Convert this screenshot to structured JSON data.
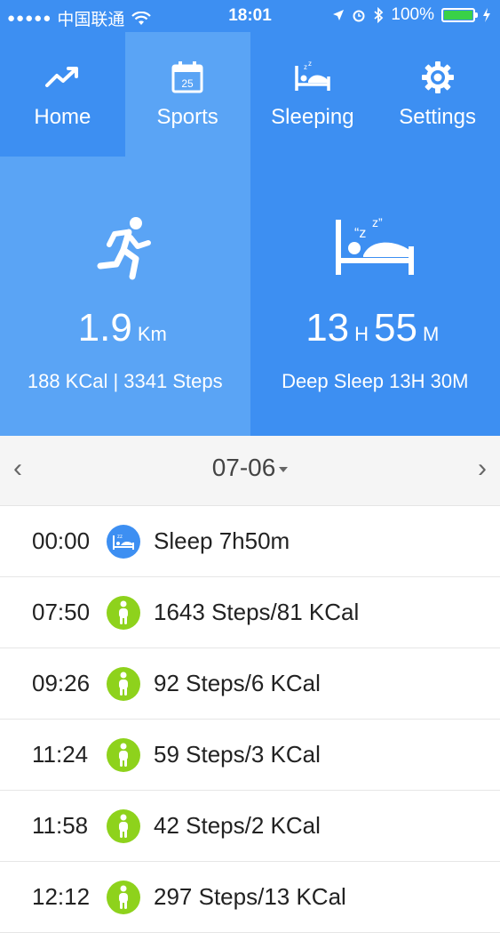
{
  "status_bar": {
    "signal": "●●●●●",
    "carrier": "中国联通",
    "time": "18:01",
    "battery": "100%",
    "battery_level": 100
  },
  "nav": {
    "tabs": [
      {
        "label": "Home",
        "icon": "trend-icon",
        "active": false
      },
      {
        "label": "Sports",
        "icon": "calendar-icon",
        "active": true
      },
      {
        "label": "Sleeping",
        "icon": "bed-icon",
        "active": false
      },
      {
        "label": "Settings",
        "icon": "gear-icon",
        "active": false
      }
    ],
    "calendar_day": "25"
  },
  "sport": {
    "distance": "1.9",
    "distance_unit": "Km",
    "details": "188 KCal | 3341 Steps"
  },
  "sleep": {
    "hours": "13",
    "hours_unit": "H",
    "minutes": "55",
    "minutes_unit": "M",
    "details": "Deep Sleep 13H 30M"
  },
  "date_bar": {
    "prev": "‹",
    "date": "07-06",
    "next": "›"
  },
  "activities": [
    {
      "time": "00:00",
      "type": "sleep",
      "text": "Sleep 7h50m"
    },
    {
      "time": "07:50",
      "type": "walk",
      "text": "1643 Steps/81 KCal"
    },
    {
      "time": "09:26",
      "type": "walk",
      "text": "92 Steps/6 KCal"
    },
    {
      "time": "11:24",
      "type": "walk",
      "text": "59 Steps/3 KCal"
    },
    {
      "time": "11:58",
      "type": "walk",
      "text": "42 Steps/2 KCal"
    },
    {
      "time": "12:12",
      "type": "walk",
      "text": "297 Steps/13 KCal"
    }
  ],
  "colors": {
    "primary": "#3d8ff2",
    "highlight": "#5aa4f5",
    "walk": "#8ed21c"
  }
}
